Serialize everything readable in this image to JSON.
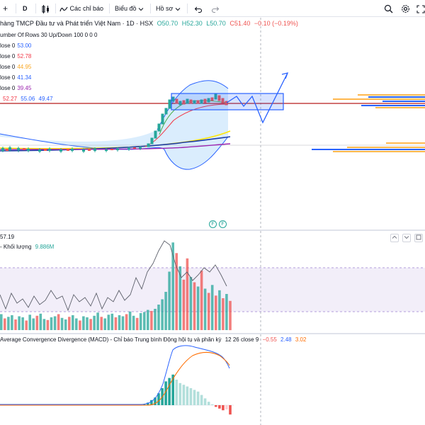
{
  "toolbar": {
    "plus": "+",
    "interval": "D",
    "indicators_label": "Các chỉ báo",
    "chart_label": "Biểu đồ",
    "templates_label": "Hồ sơ"
  },
  "main": {
    "title": "hàng TMCP Đầu tư và Phát triển Việt Nam · 1D · HSX",
    "ohlc": {
      "o_label": "O",
      "o": "50.70",
      "h_label": "H",
      "h": "52.30",
      "l_label": "L",
      "l": "50.70",
      "c_label": "C",
      "c": "51.40",
      "change": "−0.10 (−0.19%)"
    },
    "vp_settings": "umber Of Rows 30 Up/Down 100  0  0  0",
    "ma_lines": [
      {
        "label": "lose 0",
        "value": "53.00",
        "color": "#2962ff"
      },
      {
        "label": "lose 0",
        "value": "52.78",
        "color": "#f23645"
      },
      {
        "label": "lose 0",
        "value": "44.95",
        "color": "#ffe600"
      },
      {
        "label": "lose 0",
        "value": "41.34",
        "color": "#2962ff"
      },
      {
        "label": "lose 0",
        "value": "39.45",
        "color": "#9c27b0"
      }
    ],
    "bb": {
      "v1": "52.27",
      "v2": "55.06",
      "v3": "49.47",
      "c1": "#f23645",
      "c2": "#2962ff",
      "c3": "#2962ff"
    },
    "badge_f": "F"
  },
  "volume": {
    "value_label": "57.19",
    "title": "- Khối lượng",
    "value": "9.886M",
    "up_color": "#26a69a",
    "down_color": "#ef5350"
  },
  "macd": {
    "title": "Average Convergence Divergence (MACD) - Chỉ báo Trung bình Động hội tụ và phân kỳ",
    "params": "12 26 close 9",
    "hist": "−0.55",
    "macd": "2.48",
    "signal": "3.02",
    "macd_color": "#2962ff",
    "signal_color": "#ff6d00"
  },
  "chart_data": {
    "type": "bar",
    "title": "",
    "price_levels": {
      "last_close": 51.4,
      "resistance_line": 52.27
    },
    "volume_bars": [
      {
        "v": 30,
        "up": true
      },
      {
        "v": 22,
        "up": false
      },
      {
        "v": 25,
        "up": true
      },
      {
        "v": 28,
        "up": true
      },
      {
        "v": 20,
        "up": false
      },
      {
        "v": 26,
        "up": true
      },
      {
        "v": 24,
        "up": true
      },
      {
        "v": 18,
        "up": false
      },
      {
        "v": 29,
        "up": true
      },
      {
        "v": 22,
        "up": true
      },
      {
        "v": 27,
        "up": false
      },
      {
        "v": 31,
        "up": true
      },
      {
        "v": 21,
        "up": true
      },
      {
        "v": 19,
        "up": false
      },
      {
        "v": 24,
        "up": true
      },
      {
        "v": 26,
        "up": true
      },
      {
        "v": 30,
        "up": false
      },
      {
        "v": 23,
        "up": true
      },
      {
        "v": 20,
        "up": true
      },
      {
        "v": 25,
        "up": false
      },
      {
        "v": 28,
        "up": true
      },
      {
        "v": 22,
        "up": true
      },
      {
        "v": 18,
        "up": false
      },
      {
        "v": 26,
        "up": true
      },
      {
        "v": 24,
        "up": true
      },
      {
        "v": 21,
        "up": false
      },
      {
        "v": 27,
        "up": true
      },
      {
        "v": 33,
        "up": true
      },
      {
        "v": 25,
        "up": false
      },
      {
        "v": 22,
        "up": true
      },
      {
        "v": 29,
        "up": true
      },
      {
        "v": 31,
        "up": true
      },
      {
        "v": 24,
        "up": false
      },
      {
        "v": 28,
        "up": true
      },
      {
        "v": 26,
        "up": true
      },
      {
        "v": 30,
        "up": false
      },
      {
        "v": 35,
        "up": true
      },
      {
        "v": 27,
        "up": true
      },
      {
        "v": 23,
        "up": false
      },
      {
        "v": 32,
        "up": true
      },
      {
        "v": 34,
        "up": true
      },
      {
        "v": 38,
        "up": true
      },
      {
        "v": 36,
        "up": false
      },
      {
        "v": 40,
        "up": true
      },
      {
        "v": 48,
        "up": true
      },
      {
        "v": 58,
        "up": true
      },
      {
        "v": 72,
        "up": true
      },
      {
        "v": 110,
        "up": true
      },
      {
        "v": 165,
        "up": true
      },
      {
        "v": 145,
        "up": false
      },
      {
        "v": 120,
        "up": true
      },
      {
        "v": 95,
        "up": false
      },
      {
        "v": 135,
        "up": false
      },
      {
        "v": 100,
        "up": true
      },
      {
        "v": 90,
        "up": false
      },
      {
        "v": 82,
        "up": true
      },
      {
        "v": 112,
        "up": false
      },
      {
        "v": 78,
        "up": true
      },
      {
        "v": 70,
        "up": false
      },
      {
        "v": 85,
        "up": true
      },
      {
        "v": 65,
        "up": false
      },
      {
        "v": 75,
        "up": true
      },
      {
        "v": 60,
        "up": false
      },
      {
        "v": 68,
        "up": true
      },
      {
        "v": 55,
        "up": false
      }
    ],
    "macd_hist": [
      0,
      0,
      0,
      0,
      0,
      0,
      0,
      0,
      0,
      0,
      0,
      0,
      0,
      0,
      0,
      0,
      0,
      0,
      0,
      0,
      0,
      0,
      0,
      0,
      0,
      0,
      0,
      0,
      0,
      0,
      0,
      0,
      0,
      0,
      0,
      0,
      0,
      0,
      0,
      0,
      0.1,
      0.3,
      0.6,
      0.9,
      1.4,
      2.0,
      2.8,
      3.2,
      3.6,
      3.0,
      2.6,
      2.4,
      2.2,
      2.0,
      1.8,
      1.6,
      1.2,
      0.8,
      0.4,
      0.1,
      -0.2,
      -0.4,
      -0.6,
      -0.5,
      -1.1
    ]
  }
}
